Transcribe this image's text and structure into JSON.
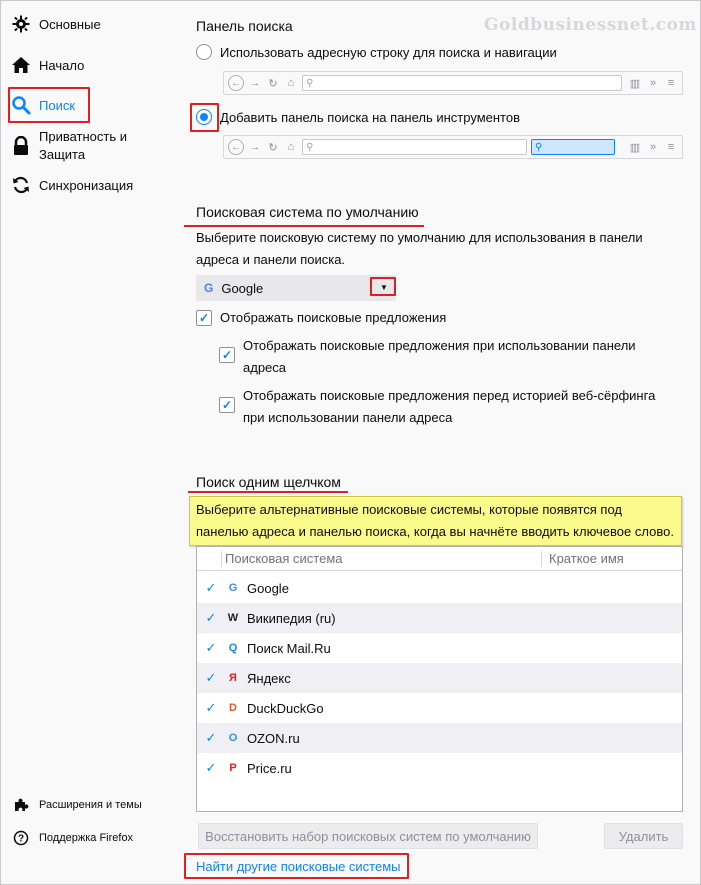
{
  "watermark": "Goldbusinessnet.com",
  "sidebar": {
    "items": [
      {
        "label": "Основные",
        "icon": "gear-icon"
      },
      {
        "label": "Начало",
        "icon": "home-icon"
      },
      {
        "label": "Поиск",
        "icon": "search-icon"
      },
      {
        "label": "Приватность и Защита",
        "icon": "lock-icon"
      },
      {
        "label": "Синхронизация",
        "icon": "sync-icon"
      }
    ],
    "footer": [
      {
        "label": "Расширения и темы",
        "icon": "puzzle-icon"
      },
      {
        "label": "Поддержка Firefox",
        "icon": "help-icon"
      }
    ]
  },
  "search_bar_section": {
    "title": "Панель поиска",
    "option_urlbar": "Использовать адресную строку для поиска и навигации",
    "option_searchbar": "Добавить панель поиска на панель инструментов"
  },
  "default_engine_section": {
    "title": "Поисковая система по умолчанию",
    "description": "Выберите поисковую систему по умолчанию для использования в панели адреса и панели поиска.",
    "selected_engine": "Google",
    "show_suggestions": "Отображать поисковые предложения",
    "suggest_in_urlbar": "Отображать поисковые предложения при использовании панели адреса",
    "suggest_before_history": "Отображать поисковые предложения перед историей веб-сёрфинга при использовании панели адреса"
  },
  "one_click_section": {
    "title": "Поиск одним щелчком",
    "description": "Выберите альтернативные поисковые системы, которые появятся под панелью адреса и панелью поиска, когда вы начнёте вводить ключевое слово.",
    "col_engine": "Поисковая система",
    "col_keyword": "Краткое имя",
    "engines": [
      {
        "name": "Google",
        "icon": "google-icon",
        "color": "#4285f4",
        "glyph": "G"
      },
      {
        "name": "Википедия (ru)",
        "icon": "wikipedia-icon",
        "color": "#222222",
        "glyph": "W"
      },
      {
        "name": "Поиск Mail.Ru",
        "icon": "mailru-icon",
        "color": "#168de2",
        "glyph": "Q"
      },
      {
        "name": "Яндекс",
        "icon": "yandex-icon",
        "color": "#e02020",
        "glyph": "Я"
      },
      {
        "name": "DuckDuckGo",
        "icon": "duckduckgo-icon",
        "color": "#de5833",
        "glyph": "D"
      },
      {
        "name": "OZON.ru",
        "icon": "ozon-icon",
        "color": "#1a9be0",
        "glyph": "O"
      },
      {
        "name": "Price.ru",
        "icon": "price-icon",
        "color": "#e02020",
        "glyph": "P"
      }
    ],
    "restore_button": "Восстановить набор поисковых систем по умолчанию",
    "remove_button": "Удалить",
    "find_more_link": "Найти другие поисковые системы"
  },
  "colors": {
    "accent": "#0a84ff",
    "annotation_red": "#e02020",
    "note_yellow": "#fbfb8c"
  }
}
